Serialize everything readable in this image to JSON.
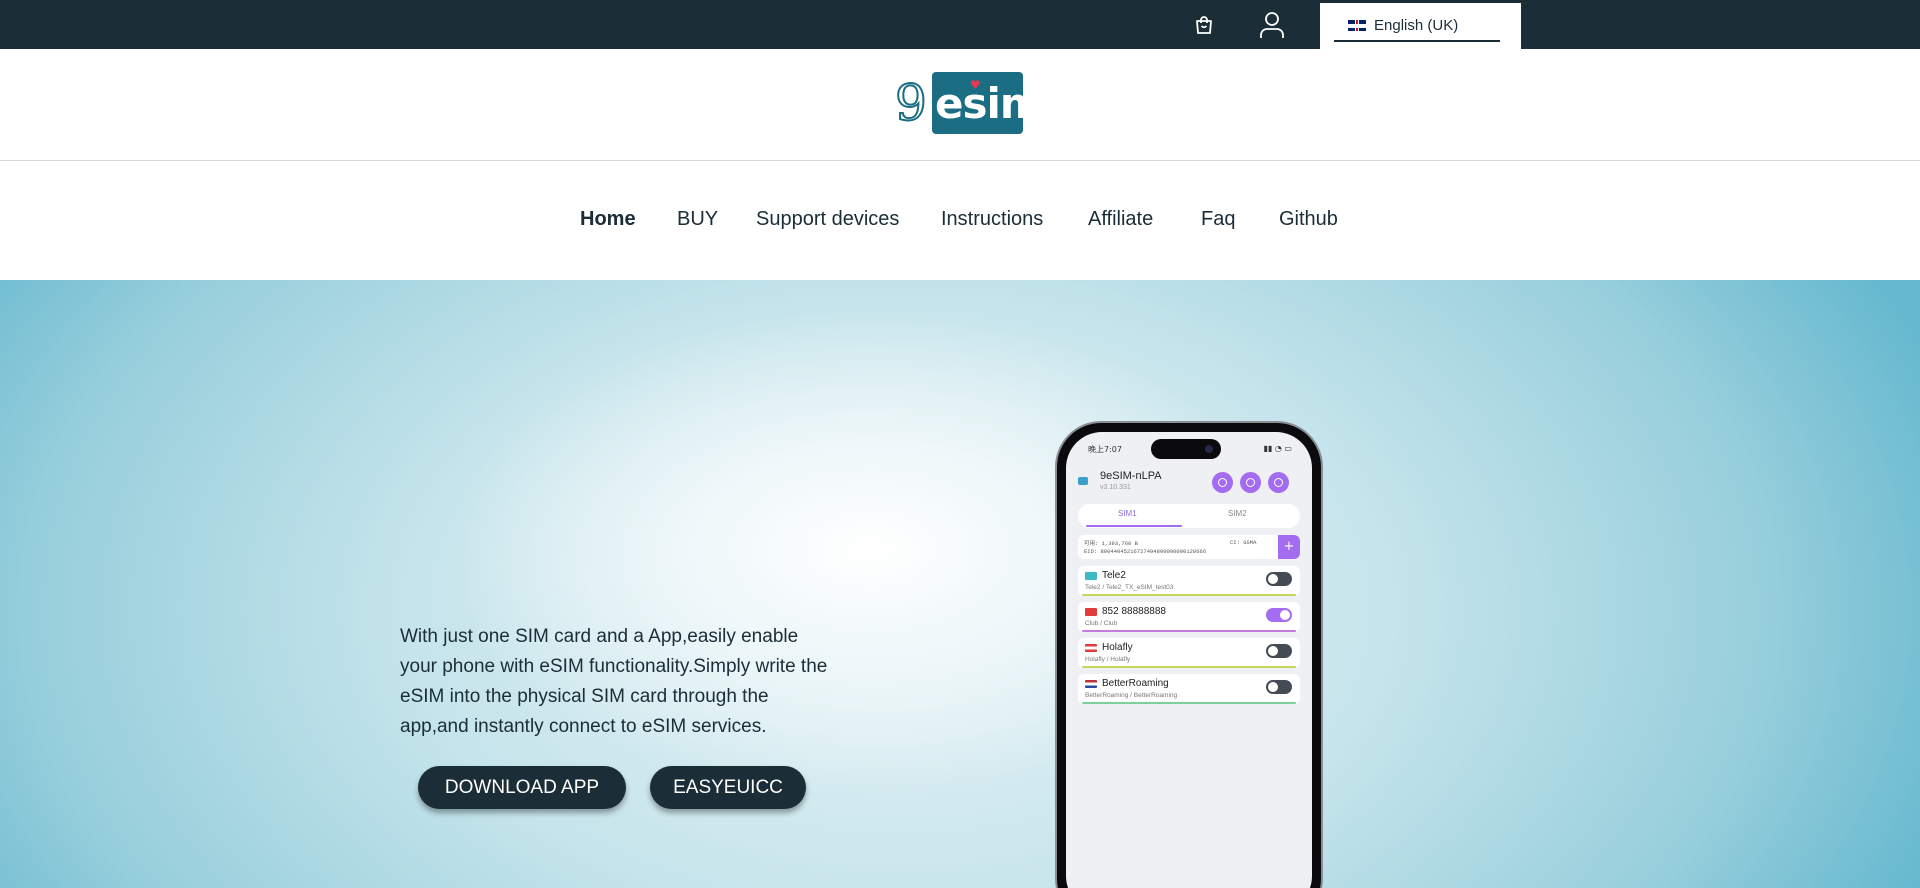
{
  "topbar": {
    "cart_icon": "shopping-bag-icon",
    "account_icon": "user-icon",
    "language": "English (UK)",
    "bg_color": "#1b2d37"
  },
  "logo": {
    "nine": "9",
    "text": "esim",
    "brand_color": "#1a6d82"
  },
  "nav": {
    "items": [
      {
        "label": "Home"
      },
      {
        "label": "BUY"
      },
      {
        "label": "Support devices"
      },
      {
        "label": "Instructions"
      },
      {
        "label": "Affiliate"
      },
      {
        "label": "Faq"
      },
      {
        "label": "Github"
      }
    ]
  },
  "hero": {
    "description": "With just one SIM card and a App,easily enable your phone with eSIM functionality.Simply write the eSIM into the physical SIM card through the app,and instantly connect to eSIM services.",
    "download_button": "DOWNLOAD APP",
    "easyeuicc_button": "EASYEUICC"
  },
  "phone": {
    "status_time": "晚上7:07",
    "app_title": "9eSIM-nLPA",
    "app_version": "v3.10.331",
    "tab1": "SIM1",
    "tab2": "SIM2",
    "free_space": "可用: 1,393,760 B",
    "eid": "EID: 89044045216727494800000000128666",
    "ci": "CI: GSMA",
    "profiles": [
      {
        "name": "Tele2",
        "sub": "Tele2 / Tele2_TX_eSIM_test03",
        "enabled": false
      },
      {
        "name": "852 88888888",
        "sub": "Club / Club",
        "enabled": true
      },
      {
        "name": "Holafly",
        "sub": "Holafly / Holafly",
        "enabled": false
      },
      {
        "name": "BetterRoaming",
        "sub": "BetterRoaming / BetterRoaming",
        "enabled": false
      }
    ]
  }
}
